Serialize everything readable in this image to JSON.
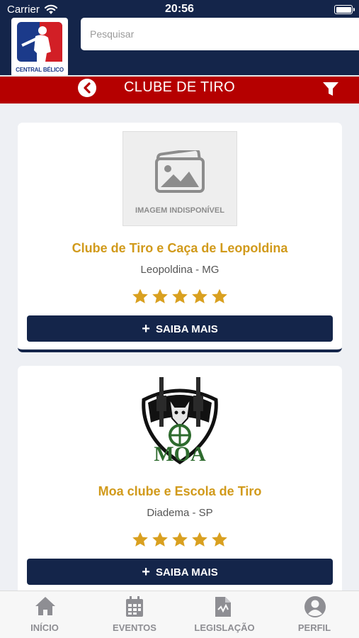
{
  "status_bar": {
    "carrier": "Carrier",
    "time": "20:56"
  },
  "header": {
    "logo_text": "CENTRAL BÉLICO",
    "search_placeholder": "Pesquisar"
  },
  "title_bar": {
    "title": "CLUBE DE TIRO"
  },
  "clubs": [
    {
      "image_placeholder": "IMAGEM INDISPONÍVEL",
      "name": "Clube de Tiro e Caça de Leopoldina",
      "location": "Leopoldina - MG",
      "rating": 5,
      "button_label": "SAIBA MAIS"
    },
    {
      "logo_text": "MOA",
      "name": "Moa clube e Escola de Tiro",
      "location": "Diadema - SP",
      "rating": 5,
      "button_label": "SAIBA MAIS"
    }
  ],
  "tab_bar": [
    {
      "label": "INÍCIO",
      "icon": "home-icon"
    },
    {
      "label": "EVENTOS",
      "icon": "calendar-icon"
    },
    {
      "label": "LEGISLAÇÃO",
      "icon": "document-icon"
    },
    {
      "label": "PERFIL",
      "icon": "user-icon"
    }
  ],
  "colors": {
    "navy": "#14254a",
    "red_bar": "#b50000",
    "gold": "#d19a1b",
    "star": "#d9a020"
  }
}
